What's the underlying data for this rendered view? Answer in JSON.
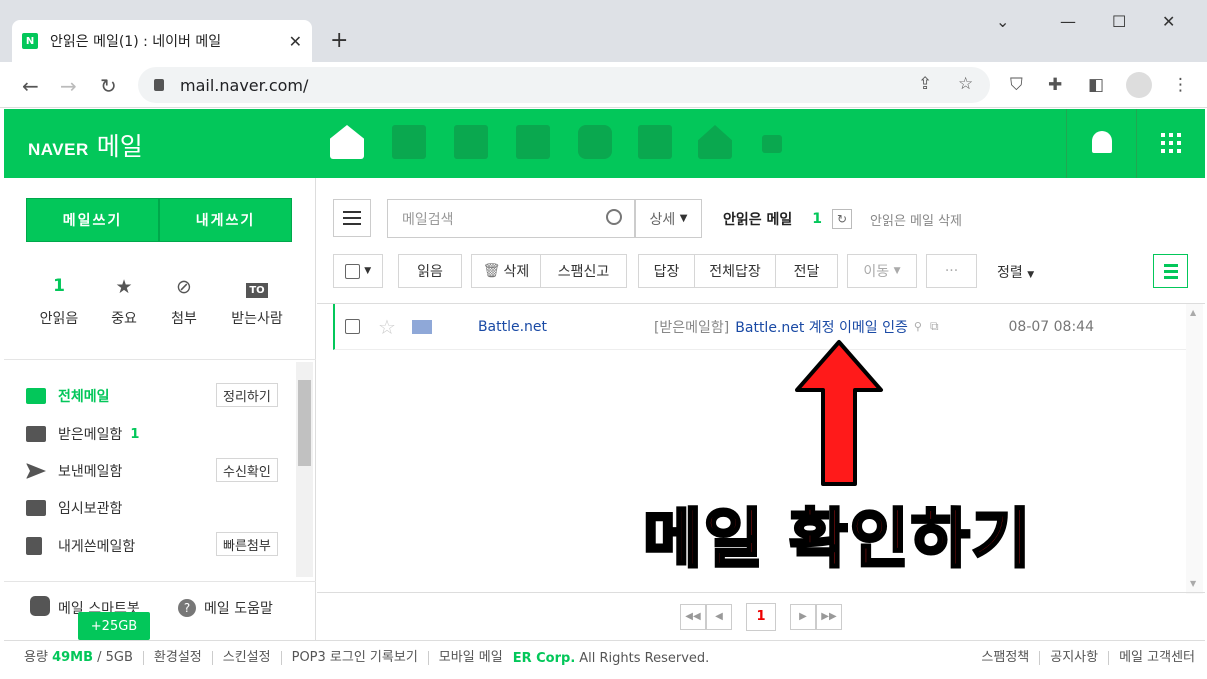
{
  "browser": {
    "tab_title": "안읽은 메일(1) : 네이버 메일",
    "url": "mail.naver.com/"
  },
  "gnb": {
    "logo_brand": "NAVER",
    "logo_service": "메일",
    "services": [
      "mail-icon",
      "calendar-icon",
      "list-icon",
      "contacts-icon",
      "box-icon",
      "memo-icon",
      "home-icon",
      "more-icon"
    ],
    "accent": "#03c75a"
  },
  "left": {
    "write_button": "메일쓰기",
    "write_self_button": "내게쓰기",
    "quick": [
      {
        "value": "1",
        "label": "안읽음"
      },
      {
        "label": "중요"
      },
      {
        "label": "첨부"
      },
      {
        "label": "받는사람"
      }
    ],
    "folders": [
      {
        "label": "전체메일",
        "action": "정리하기"
      },
      {
        "label": "받은메일함",
        "count": "1"
      },
      {
        "label": "보낸메일함",
        "action": "수신확인"
      },
      {
        "label": "임시보관함"
      },
      {
        "label": "내게쓴메일함",
        "action": "빠른첨부"
      }
    ],
    "smartbot": "메일 스마트봇",
    "help": "메일 도움말",
    "storage_badge": "+25GB"
  },
  "main": {
    "search_placeholder": "메일검색",
    "detail": "상세",
    "unread_label": "안읽은 메일",
    "unread_count": "1",
    "unread_delete": "안읽은 메일 삭제",
    "toolbar": {
      "read": "읽음",
      "delete": "삭제",
      "spam": "스팸신고",
      "reply": "답장",
      "reply_all": "전체답장",
      "forward": "전달",
      "move": "이동",
      "more": "···",
      "sort": "정렬"
    },
    "messages": [
      {
        "sender": "Battle.net",
        "prefix": "[받은메일함]",
        "subject": "Battle.net 계정 이메일 인증",
        "date": "08-07 08:44"
      }
    ],
    "annotation": "메일 확인하기",
    "current_page": "1"
  },
  "status": {
    "capacity_label": "용량",
    "used": "49MB",
    "total": "/ 5GB",
    "links": [
      "환경설정",
      "스킨설정",
      "POP3 로그인 기록보기",
      "모바일 메일"
    ],
    "company": "ER Corp.",
    "copyright": "All Rights Reserved.",
    "right_links": [
      "스팸정책",
      "공지사항",
      "메일 고객센터"
    ]
  }
}
